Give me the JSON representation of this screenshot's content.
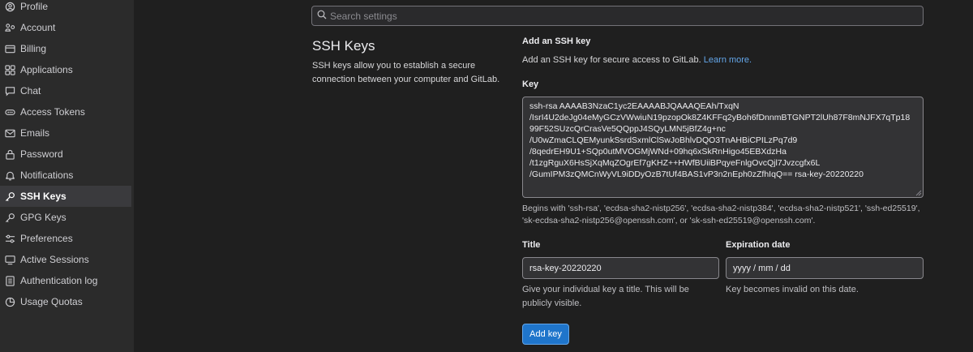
{
  "sidebar": {
    "items": [
      {
        "label": "Profile",
        "icon": "profile-icon"
      },
      {
        "label": "Account",
        "icon": "account-icon"
      },
      {
        "label": "Billing",
        "icon": "billing-icon"
      },
      {
        "label": "Applications",
        "icon": "applications-icon"
      },
      {
        "label": "Chat",
        "icon": "chat-icon"
      },
      {
        "label": "Access Tokens",
        "icon": "token-icon"
      },
      {
        "label": "Emails",
        "icon": "email-icon"
      },
      {
        "label": "Password",
        "icon": "lock-icon"
      },
      {
        "label": "Notifications",
        "icon": "bell-icon"
      },
      {
        "label": "SSH Keys",
        "icon": "key-icon",
        "active": true
      },
      {
        "label": "GPG Keys",
        "icon": "key-icon"
      },
      {
        "label": "Preferences",
        "icon": "preferences-icon"
      },
      {
        "label": "Active Sessions",
        "icon": "monitor-icon"
      },
      {
        "label": "Authentication log",
        "icon": "log-icon"
      },
      {
        "label": "Usage Quotas",
        "icon": "quota-icon"
      }
    ]
  },
  "search": {
    "placeholder": "Search settings"
  },
  "section": {
    "title": "SSH Keys",
    "description": "SSH keys allow you to establish a secure connection between your computer and GitLab."
  },
  "add": {
    "heading": "Add an SSH key",
    "description": "Add an SSH key for secure access to GitLab.",
    "learn_more": "Learn more."
  },
  "key": {
    "label": "Key",
    "value": "ssh-rsa AAAAB3NzaC1yc2EAAAABJQAAAQEAh/TxqN\n/IsrI4U2deJg04eMyGCzVWwiuN19pzopOk8Z4KFFq2yBoh6fDnnmBTGNPT2lUh87F8mNJFX7qTp18\n99F52SUzcQrCrasVe5QQppJ4SQyLMN5jBfZ4g+nc\n/U0wZmaCLQEMyunkSsrdSxmlClSwJoBhlvDQO3TnAHBiCPILzPq7d9\n/8qedrEH9U1+SQp0utMVOGMjWNd+09hq6xSkRnHigo45EBXdzHa\n/t1zgRguX6HsSjXqMqZOgrEf7gKHZ++HWfBUiiBPqyeFnlgOvcQjl7Jvzcgfx6L\n/GumIPM3zQMCnWyVL9iDDyOzB7tUf4BAS1vP3n2nEph0zZfhIqQ== rsa-key-20220220",
    "hint": "Begins with 'ssh-rsa', 'ecdsa-sha2-nistp256', 'ecdsa-sha2-nistp384', 'ecdsa-sha2-nistp521', 'ssh-ed25519', 'sk-ecdsa-sha2-nistp256@openssh.com', or 'sk-ssh-ed25519@openssh.com'."
  },
  "title_field": {
    "label": "Title",
    "value": "rsa-key-20220220",
    "help": "Give your individual key a title. This will be publicly visible."
  },
  "expiration": {
    "label": "Expiration date",
    "placeholder": "yyyy / mm / dd",
    "help": "Key becomes invalid on this date."
  },
  "submit": {
    "label": "Add key"
  },
  "colors": {
    "accent": "#1f75cb",
    "link": "#63a6e9",
    "sidebar_bg": "#2b2b2b",
    "page_bg": "#1f1f1f"
  }
}
